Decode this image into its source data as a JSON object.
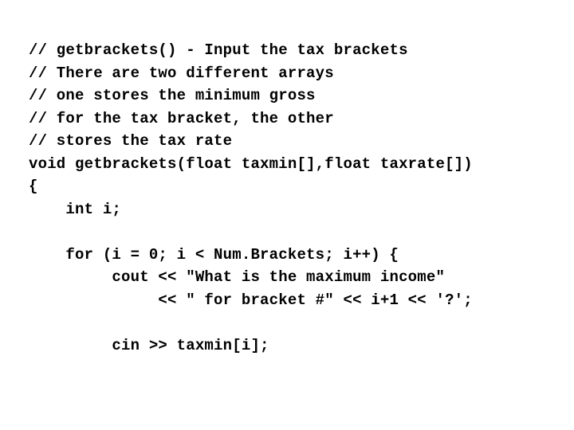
{
  "code": {
    "lines": [
      "// getbrackets() - Input the tax brackets",
      "// There are two different arrays",
      "// one stores the minimum gross",
      "// for the tax bracket, the other",
      "// stores the tax rate",
      "void getbrackets(float taxmin[],float taxrate[])",
      "{",
      "    int i;",
      "",
      "    for (i = 0; i < Num.Brackets; i++) {",
      "         cout << \"What is the maximum income\"",
      "              << \" for bracket #\" << i+1 << '?';",
      "",
      "         cin >> taxmin[i];"
    ]
  }
}
